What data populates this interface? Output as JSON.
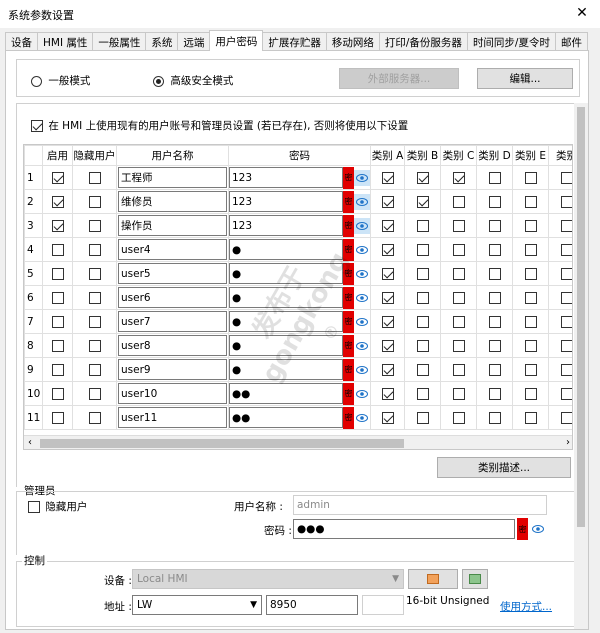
{
  "window": {
    "title": "系统参数设置",
    "close_glyph": "✕"
  },
  "tabs": [
    "设备",
    "HMI 属性",
    "一般属性",
    "系统",
    "远端",
    "用户密码",
    "扩展存贮器",
    "移动网络",
    "打印/备份服务器",
    "时间同步/夏令时",
    "邮件"
  ],
  "active_tab": "用户密码",
  "mode": {
    "general_label": "一般模式",
    "advanced_label": "高级安全模式",
    "selected": "advanced",
    "external_server_button": "外部服务器...",
    "edit_button": "编辑..."
  },
  "use_existing": {
    "checked": true,
    "label": "在 HMI 上使用现有的用户账号和管理员设置 (若已存在), 否则将使用以下设置"
  },
  "users_table": {
    "headers": [
      "启用",
      "隐藏用户",
      "用户名称",
      "密码",
      "类别 A",
      "类别 B",
      "类别 C",
      "类别 D",
      "类别 E",
      "类别"
    ],
    "rows": [
      {
        "num": "1",
        "enabled": true,
        "hidden": false,
        "name": "工程师",
        "password": "123",
        "eye_selected": true,
        "cats": [
          true,
          true,
          true,
          false,
          false,
          false
        ]
      },
      {
        "num": "2",
        "enabled": true,
        "hidden": false,
        "name": "维修员",
        "password": "123",
        "eye_selected": true,
        "cats": [
          true,
          true,
          false,
          false,
          false,
          false
        ]
      },
      {
        "num": "3",
        "enabled": true,
        "hidden": false,
        "name": "操作员",
        "password": "123",
        "eye_selected": true,
        "cats": [
          true,
          false,
          false,
          false,
          false,
          false
        ]
      },
      {
        "num": "4",
        "enabled": false,
        "hidden": false,
        "name": "user4",
        "password": "●",
        "eye_selected": false,
        "cats": [
          true,
          false,
          false,
          false,
          false,
          false
        ]
      },
      {
        "num": "5",
        "enabled": false,
        "hidden": false,
        "name": "user5",
        "password": "●",
        "eye_selected": false,
        "cats": [
          true,
          false,
          false,
          false,
          false,
          false
        ]
      },
      {
        "num": "6",
        "enabled": false,
        "hidden": false,
        "name": "user6",
        "password": "●",
        "eye_selected": false,
        "cats": [
          true,
          false,
          false,
          false,
          false,
          false
        ]
      },
      {
        "num": "7",
        "enabled": false,
        "hidden": false,
        "name": "user7",
        "password": "●",
        "eye_selected": false,
        "cats": [
          true,
          false,
          false,
          false,
          false,
          false
        ]
      },
      {
        "num": "8",
        "enabled": false,
        "hidden": false,
        "name": "user8",
        "password": "●",
        "eye_selected": false,
        "cats": [
          true,
          false,
          false,
          false,
          false,
          false
        ]
      },
      {
        "num": "9",
        "enabled": false,
        "hidden": false,
        "name": "user9",
        "password": "●",
        "eye_selected": false,
        "cats": [
          true,
          false,
          false,
          false,
          false,
          false
        ]
      },
      {
        "num": "10",
        "enabled": false,
        "hidden": false,
        "name": "user10",
        "password": "●●",
        "eye_selected": false,
        "cats": [
          true,
          false,
          false,
          false,
          false,
          false
        ]
      },
      {
        "num": "11",
        "enabled": false,
        "hidden": false,
        "name": "user11",
        "password": "●●",
        "eye_selected": false,
        "cats": [
          true,
          false,
          false,
          false,
          false,
          false
        ]
      }
    ],
    "key_glyph": "密"
  },
  "category_desc_button": "类别描述...",
  "admin": {
    "group_label": "管理员",
    "hide_user_label": "隐藏用户",
    "hide_user_checked": false,
    "username_label": "用户名称 :",
    "username_value": "admin",
    "password_label": "密码 :",
    "password_value": "●●●"
  },
  "control": {
    "group_label": "控制",
    "device_label": "设备 :",
    "device_value": "Local HMI",
    "address_label": "地址 :",
    "address_type": "LW",
    "address_value": "8950",
    "data_format": "16-bit Unsigned",
    "usage_link": "使用方式..."
  },
  "watermark": {
    "line1": "发布于",
    "line2": "gongkong",
    "mark": "®"
  },
  "colors": {
    "key_red": "#e10000",
    "link_blue": "#0066cc",
    "selected_bg": "#cce4f7"
  }
}
